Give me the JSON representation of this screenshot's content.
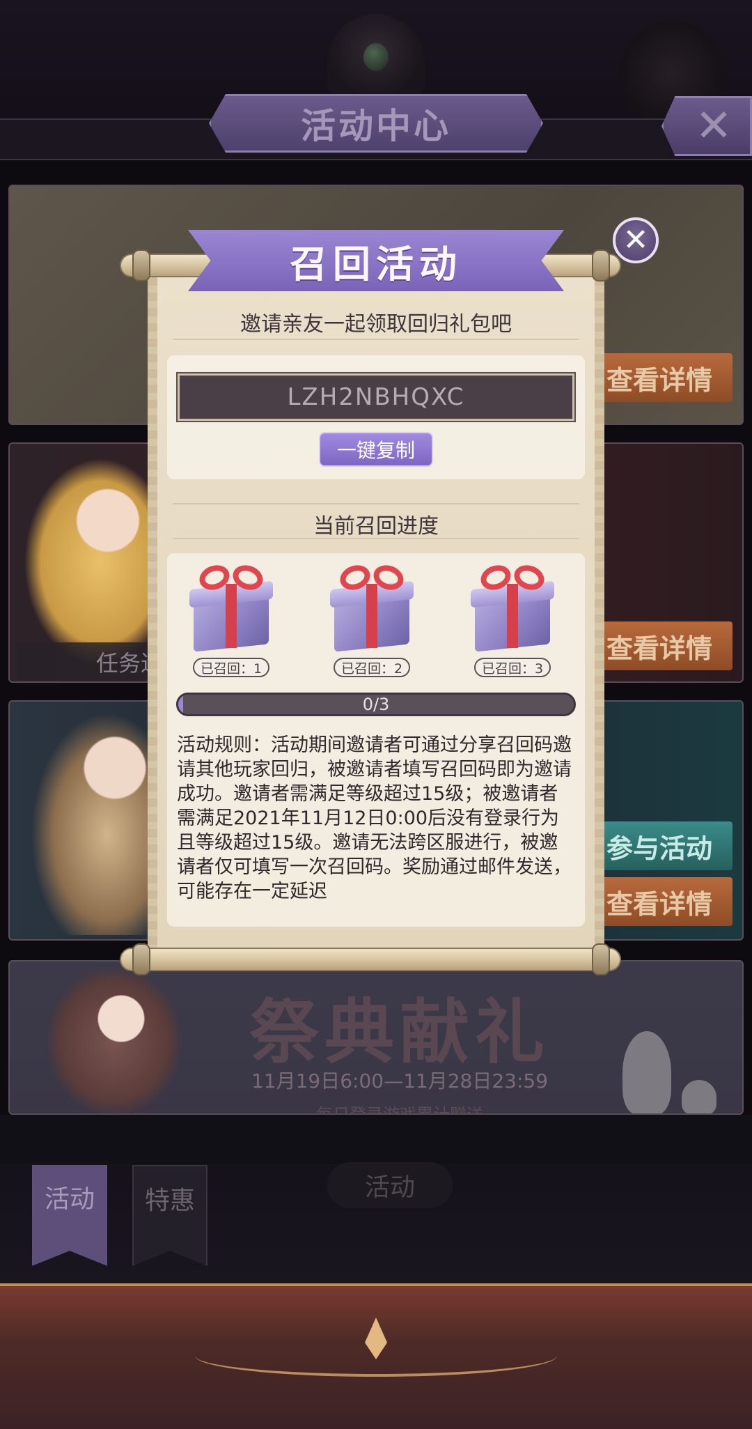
{
  "header": {
    "title": "活动中心",
    "close_icon": "close-icon"
  },
  "cards": [
    {
      "button_label": "查看详情"
    },
    {
      "task_label": "任务进",
      "button_label": "查看详情"
    },
    {
      "join_label": "参与活动",
      "button_label": "查看详情"
    },
    {
      "banner_title": "祭典献礼",
      "banner_date": "11月19日6:00—11月28日23:59",
      "banner_subtitle": "每日登录游戏累计赠送"
    }
  ],
  "bottom_nav": {
    "center_label": "活动",
    "tabs": [
      {
        "label": "活动",
        "active": true
      },
      {
        "label": "特惠",
        "active": false
      }
    ]
  },
  "modal": {
    "title": "召回活动",
    "subtitle": "邀请亲友一起领取回归礼包吧",
    "invite_code": "LZH2NBHQXC",
    "copy_button": "一键复制",
    "progress_title": "当前召回进度",
    "rewards": [
      {
        "label": "已召回：1",
        "icon": "gift-box-icon"
      },
      {
        "label": "已召回：2",
        "icon": "gift-box-icon"
      },
      {
        "label": "已召回：3",
        "icon": "gift-box-icon"
      }
    ],
    "progress": {
      "current": 0,
      "total": 3,
      "text": "0/3"
    },
    "rules": "活动规则：活动期间邀请者可通过分享召回码邀请其他玩家回归，被邀请者填写召回码即为邀请成功。邀请者需满足等级超过15级；被邀请者需满足2021年11月12日0:00后没有登录行为且等级超过15级。邀请无法跨区服进行，被邀请者仅可填写一次召回码。奖励通过邮件发送，可能存在一定延迟",
    "close_icon": "close-icon"
  },
  "colors": {
    "accent_purple": "#9b86d4",
    "parchment": "#e6dac3",
    "code_box": "#4a3f47",
    "detail_button": "#b86a3c",
    "join_button": "#3a8c8a"
  }
}
